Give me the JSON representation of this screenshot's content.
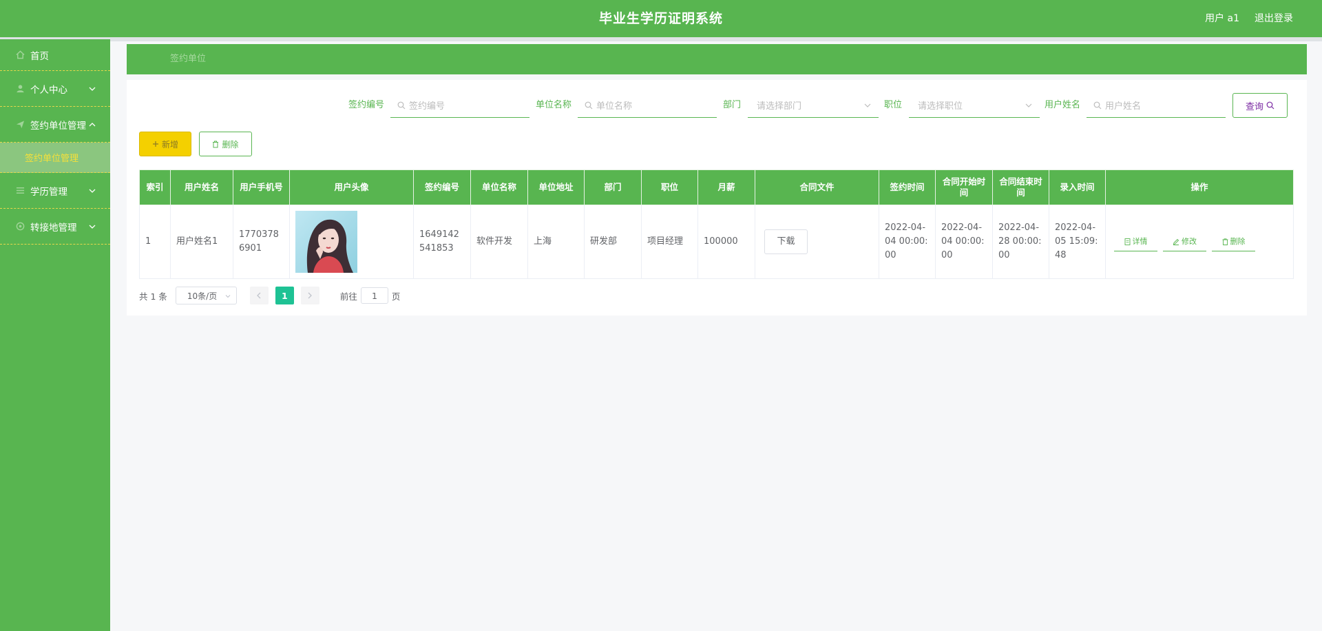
{
  "header": {
    "title": "毕业生学历证明系统",
    "user_label": "用户 a1",
    "logout_label": "退出登录"
  },
  "sidebar": {
    "items": [
      {
        "label": "首页",
        "icon": "home-icon"
      },
      {
        "label": "个人中心",
        "icon": "user-icon"
      },
      {
        "label": "签约单位管理",
        "icon": "send-icon",
        "expanded": true
      },
      {
        "label": "学历管理",
        "icon": "list-icon"
      },
      {
        "label": "转接地管理",
        "icon": "location-icon"
      }
    ],
    "subitem": {
      "label": "签约单位管理"
    }
  },
  "breadcrumb": {
    "current": "签约单位"
  },
  "search": {
    "sign_no": {
      "label": "签约编号",
      "placeholder": "签约编号"
    },
    "unit_name": {
      "label": "单位名称",
      "placeholder": "单位名称"
    },
    "dept": {
      "label": "部门",
      "placeholder": "请选择部门"
    },
    "position": {
      "label": "职位",
      "placeholder": "请选择职位"
    },
    "user_name": {
      "label": "用户姓名",
      "placeholder": "用户姓名"
    },
    "query_label": "查询"
  },
  "actions": {
    "add_label": "新增",
    "delete_label": "删除"
  },
  "table": {
    "columns": [
      "索引",
      "用户姓名",
      "用户手机号",
      "用户头像",
      "签约编号",
      "单位名称",
      "单位地址",
      "部门",
      "职位",
      "月薪",
      "合同文件",
      "签约时间",
      "合同开始时间",
      "合同结束时间",
      "录入时间",
      "操作"
    ],
    "rows": [
      {
        "index": "1",
        "name": "用户姓名1",
        "phone": "17703786901",
        "sign_no": "1649142541853",
        "unit_name": "软件开发",
        "unit_addr": "上海",
        "dept": "研发部",
        "position": "项目经理",
        "salary": "100000",
        "download_label": "下载",
        "sign_time": "2022-04-04 00:00:00",
        "start_time": "2022-04-04 00:00:00",
        "end_time": "2022-04-28 00:00:00",
        "entry_time": "2022-04-05 15:09:48",
        "op_detail": "详情",
        "op_edit": "修改",
        "op_delete": "删除"
      }
    ]
  },
  "pager": {
    "total": "共 1 条",
    "page_size": "10条/页",
    "current_page": "1",
    "goto_label": "前往",
    "goto_value": "1",
    "page_unit": "页"
  },
  "colors": {
    "primary": "#58b550",
    "warning": "#f4d000",
    "active_page": "#1ec294"
  }
}
